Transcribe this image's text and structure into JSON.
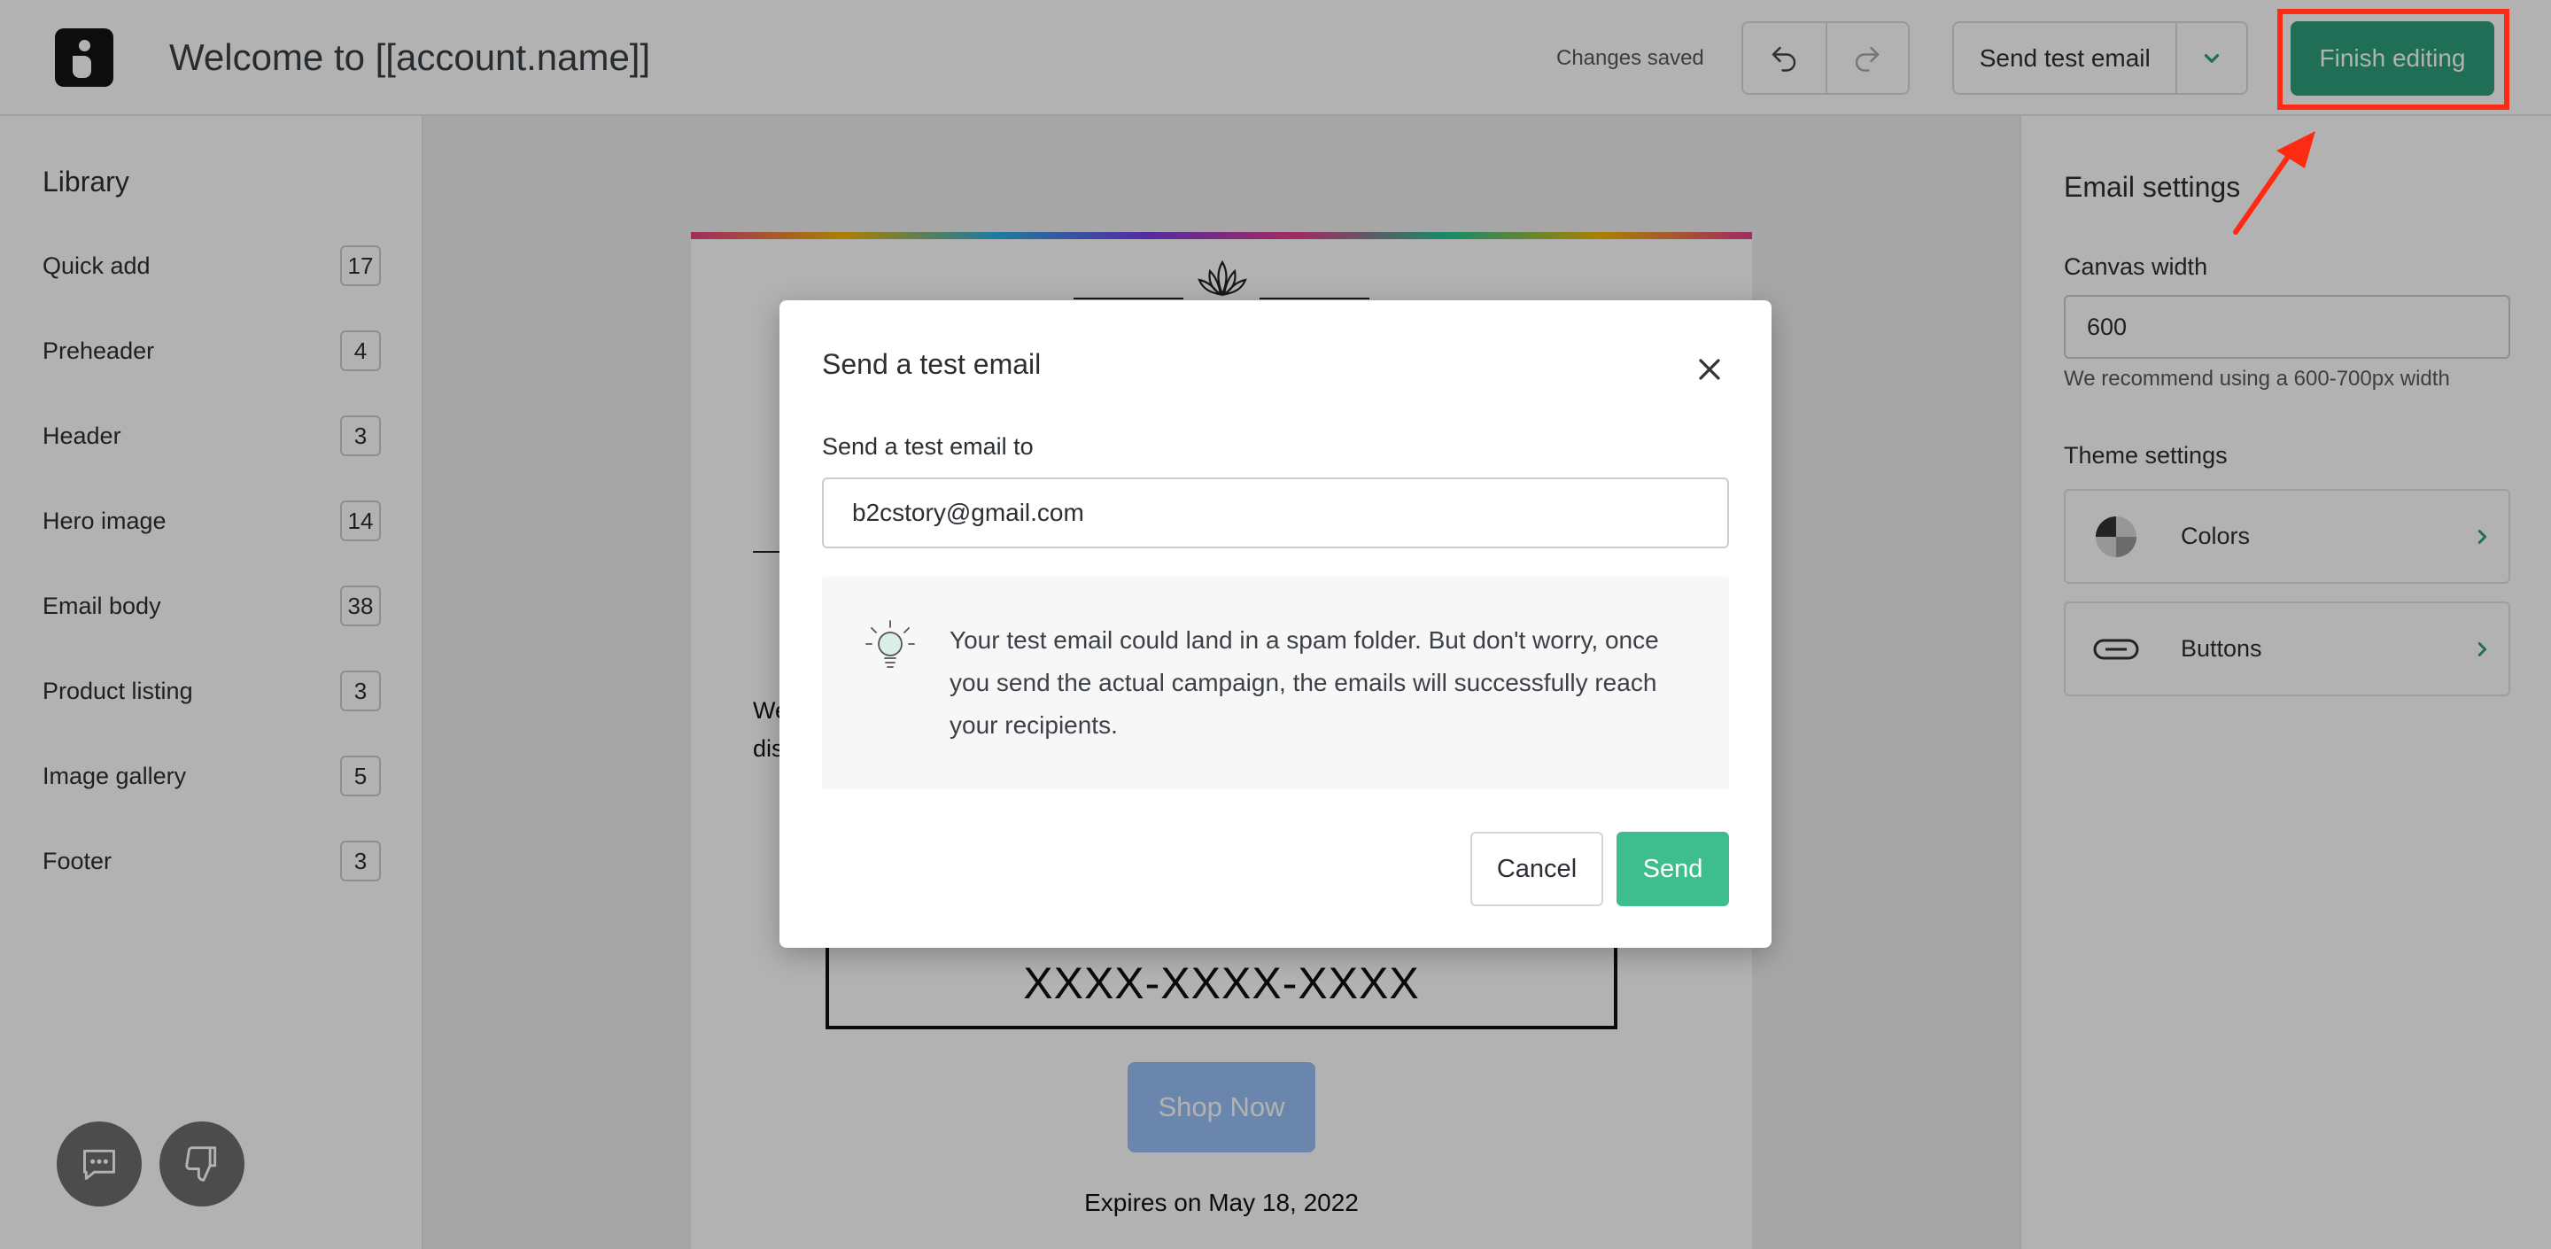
{
  "topbar": {
    "title": "Welcome to [[account.name]]",
    "status": "Changes saved",
    "send_test_label": "Send test email",
    "finish_label": "Finish editing"
  },
  "library": {
    "title": "Library",
    "items": [
      {
        "label": "Quick add",
        "count": "17"
      },
      {
        "label": "Preheader",
        "count": "4"
      },
      {
        "label": "Header",
        "count": "3"
      },
      {
        "label": "Hero image",
        "count": "14"
      },
      {
        "label": "Email body",
        "count": "38"
      },
      {
        "label": "Product listing",
        "count": "3"
      },
      {
        "label": "Image gallery",
        "count": "5"
      },
      {
        "label": "Footer",
        "count": "3"
      }
    ]
  },
  "email_preview": {
    "body_fragment_1": "We",
    "body_fragment_2": "dis",
    "code": "XXXX-XXXX-XXXX",
    "shop_button": "Shop Now",
    "expires": "Expires on May 18, 2022"
  },
  "settings": {
    "title": "Email settings",
    "canvas_width_label": "Canvas width",
    "canvas_width_value": "600",
    "canvas_width_hint": "We recommend using a 600-700px width",
    "theme_title": "Theme settings",
    "theme_items": [
      {
        "label": "Colors",
        "icon": "pie-chart-icon"
      },
      {
        "label": "Buttons",
        "icon": "button-shape-icon"
      }
    ]
  },
  "modal": {
    "title": "Send a test email",
    "field_label": "Send a test email to",
    "email_value": "b2cstory@gmail.com",
    "notice": "Your test email could land in a spam folder. But don't worry, once you send the actual campaign, the emails will successfully reach your recipients.",
    "cancel_label": "Cancel",
    "send_label": "Send"
  },
  "colors": {
    "accent": "#2f9e7a",
    "send_button": "#3ebd8f",
    "highlight": "#ff2a14",
    "shop_button": "#98c1f7"
  }
}
